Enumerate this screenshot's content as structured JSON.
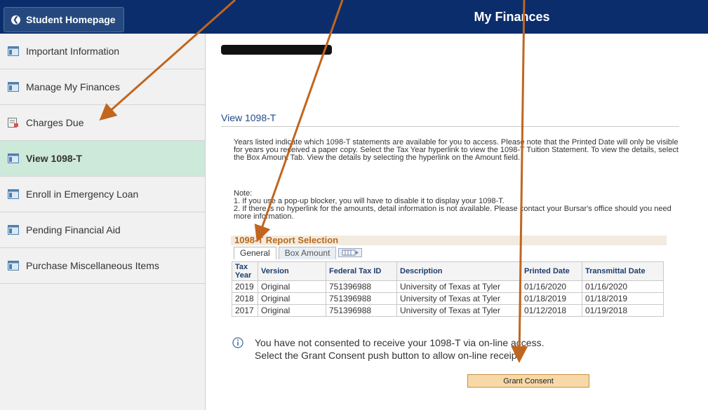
{
  "header": {
    "home_label": "Student Homepage",
    "page_title": "My Finances",
    "bar_color": "#0b2d6b"
  },
  "sidebar": {
    "items": [
      {
        "label": "Important Information",
        "icon": "folder-icon"
      },
      {
        "label": "Manage My Finances",
        "icon": "folder-icon"
      },
      {
        "label": "Charges Due",
        "icon": "report-icon"
      },
      {
        "label": "View 1098-T",
        "icon": "folder-icon",
        "active": true
      },
      {
        "label": "Enroll in Emergency Loan",
        "icon": "folder-icon"
      },
      {
        "label": "Pending Financial Aid",
        "icon": "folder-icon"
      },
      {
        "label": "Purchase Miscellaneous Items",
        "icon": "folder-icon"
      }
    ]
  },
  "main": {
    "section_title": "View 1098-T",
    "intro_text": "Years listed indicate which 1098-T statements are available for you to access. Please note that the Printed Date will only be visible for years you received a paper copy. Select the Tax Year hyperlink to view the 1098-T Tuition Statement. To view the details, select the Box Amount Tab. View the details by selecting the hyperlink on the Amount field.",
    "note_label": "Note:",
    "note_1": "1. If you use a pop-up blocker, you will have to disable it to display your 1098-T.",
    "note_2": "2. If there is no hyperlink for the amounts, detail information is not available. Please contact your Bursar's office should you need more information.",
    "report_title": "1098-T Report Selection",
    "tabs": [
      "General",
      "Box Amount"
    ],
    "columns": [
      "Tax Year",
      "Version",
      "Federal Tax ID",
      "Description",
      "Printed Date",
      "Transmittal Date"
    ],
    "rows": [
      [
        "2019",
        "Original",
        "751396988",
        "University of Texas at Tyler",
        "01/16/2020",
        "01/16/2020"
      ],
      [
        "2018",
        "Original",
        "751396988",
        "University of Texas at Tyler",
        "01/18/2019",
        "01/18/2019"
      ],
      [
        "2017",
        "Original",
        "751396988",
        "University of Texas at Tyler",
        "01/12/2018",
        "01/19/2018"
      ]
    ],
    "consent_line_1": "You have not consented to receive your 1098-T via on-line access.",
    "consent_line_2": "Select the Grant Consent push button to allow on-line receipt.",
    "grant_button": "Grant Consent"
  },
  "colors": {
    "accent_orange": "#c0661f",
    "active_item_bg": "#cde9d9",
    "report_title_color": "#b76b1c"
  }
}
